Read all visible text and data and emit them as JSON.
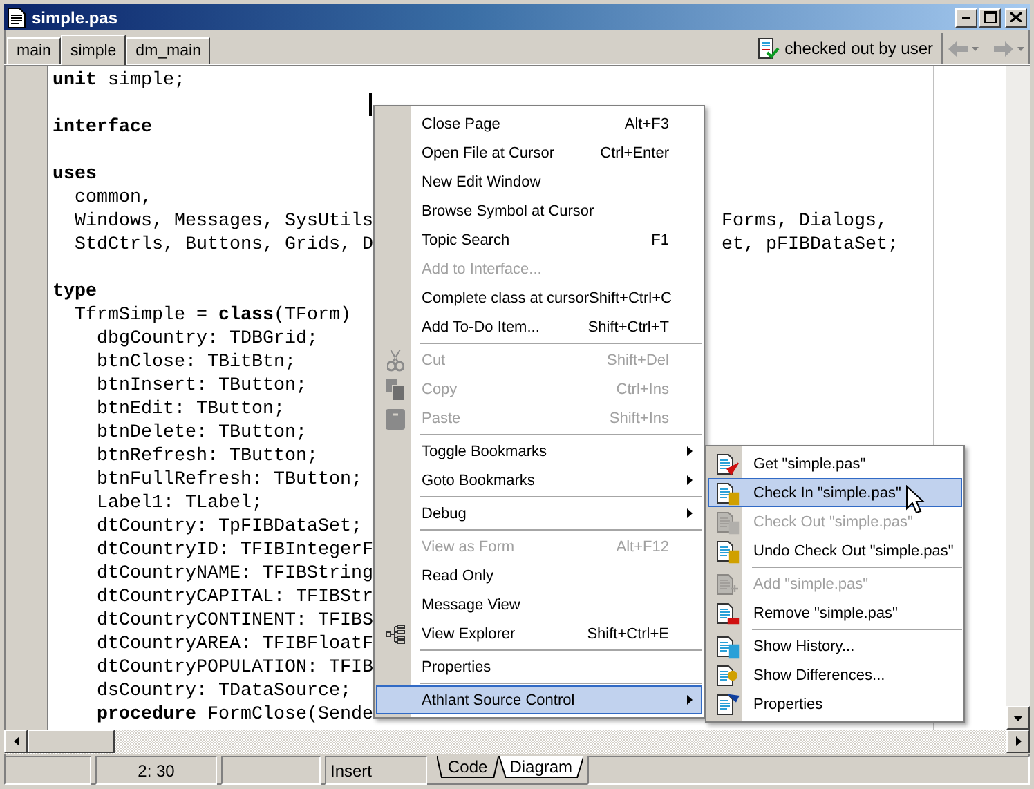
{
  "window": {
    "title": "simple.pas"
  },
  "tabs": [
    {
      "label": "main",
      "selected": false
    },
    {
      "label": "simple",
      "selected": true
    },
    {
      "label": "dm_main",
      "selected": false
    }
  ],
  "source_status": "checked out by user",
  "editor": {
    "lines": [
      {
        "kind": "code",
        "text": "**unit** simple;"
      },
      {
        "kind": "blank"
      },
      {
        "kind": "code",
        "text": "interface",
        "bold": true
      },
      {
        "kind": "blank"
      },
      {
        "kind": "code",
        "text": "uses",
        "bold": true
      },
      {
        "kind": "code",
        "text": "  common,"
      },
      {
        "kind": "code",
        "text": "  Windows, Messages, SysUtils",
        "tail": "Forms, Dialogs,"
      },
      {
        "kind": "code",
        "text": "  StdCtrls, Buttons, Grids, D",
        "tail": "et, pFIBDataSet;"
      },
      {
        "kind": "blank"
      },
      {
        "kind": "code",
        "text": "type",
        "bold": true
      },
      {
        "kind": "code",
        "text": "  TfrmSimple = **class**(TForm)"
      },
      {
        "kind": "code",
        "text": "    dbgCountry: TDBGrid;"
      },
      {
        "kind": "code",
        "text": "    btnClose: TBitBtn;"
      },
      {
        "kind": "code",
        "text": "    btnInsert: TButton;"
      },
      {
        "kind": "code",
        "text": "    btnEdit: TButton;"
      },
      {
        "kind": "code",
        "text": "    btnDelete: TButton;"
      },
      {
        "kind": "code",
        "text": "    btnRefresh: TButton;"
      },
      {
        "kind": "code",
        "text": "    btnFullRefresh: TButton;"
      },
      {
        "kind": "code",
        "text": "    Label1: TLabel;"
      },
      {
        "kind": "code",
        "text": "    dtCountry: TpFIBDataSet;"
      },
      {
        "kind": "code",
        "text": "    dtCountryID: TFIBIntegerF"
      },
      {
        "kind": "code",
        "text": "    dtCountryNAME: TFIBString"
      },
      {
        "kind": "code",
        "text": "    dtCountryCAPITAL: TFIBStr"
      },
      {
        "kind": "code",
        "text": "    dtCountryCONTINENT: TFIBS"
      },
      {
        "kind": "code",
        "text": "    dtCountryAREA: TFIBFloatF"
      },
      {
        "kind": "code",
        "text": "    dtCountryPOPULATION: TFIB"
      },
      {
        "kind": "code",
        "text": "    dsCountry: TDataSource;"
      },
      {
        "kind": "code",
        "text": "    **procedure** FormClose(Sende"
      }
    ]
  },
  "context_menu": {
    "items": [
      {
        "kind": "item",
        "label": "Close Page",
        "shortcut": "Alt+F3",
        "disabled": false,
        "selected": false,
        "submenu": false
      },
      {
        "kind": "item",
        "label": "Open File at Cursor",
        "shortcut": "Ctrl+Enter",
        "disabled": false,
        "selected": false,
        "submenu": false
      },
      {
        "kind": "item",
        "label": "New Edit Window",
        "disabled": false,
        "selected": false,
        "submenu": false
      },
      {
        "kind": "item",
        "label": "Browse Symbol at Cursor",
        "disabled": false,
        "selected": false,
        "submenu": false
      },
      {
        "kind": "item",
        "label": "Topic Search",
        "shortcut": "F1",
        "disabled": false,
        "selected": false,
        "submenu": false
      },
      {
        "kind": "item",
        "label": "Add to Interface...",
        "disabled": true,
        "selected": false,
        "submenu": false
      },
      {
        "kind": "item",
        "label": "Complete class at cursor",
        "shortcut": "Shift+Ctrl+C",
        "disabled": false,
        "selected": false,
        "submenu": false
      },
      {
        "kind": "item",
        "label": "Add To-Do Item...",
        "shortcut": "Shift+Ctrl+T",
        "disabled": false,
        "selected": false,
        "submenu": false
      },
      {
        "kind": "separator"
      },
      {
        "kind": "item",
        "label": "Cut",
        "shortcut": "Shift+Del",
        "disabled": true,
        "selected": false,
        "submenu": false
      },
      {
        "kind": "item",
        "label": "Copy",
        "shortcut": "Ctrl+Ins",
        "disabled": true,
        "selected": false,
        "submenu": false
      },
      {
        "kind": "item",
        "label": "Paste",
        "shortcut": "Shift+Ins",
        "disabled": true,
        "selected": false,
        "submenu": false
      },
      {
        "kind": "separator"
      },
      {
        "kind": "item",
        "label": "Toggle Bookmarks",
        "disabled": false,
        "selected": false,
        "submenu": true
      },
      {
        "kind": "item",
        "label": "Goto Bookmarks",
        "disabled": false,
        "selected": false,
        "submenu": true
      },
      {
        "kind": "separator"
      },
      {
        "kind": "item",
        "label": "Debug",
        "disabled": false,
        "selected": false,
        "submenu": true
      },
      {
        "kind": "separator"
      },
      {
        "kind": "item",
        "label": "View as Form",
        "shortcut": "Alt+F12",
        "disabled": true,
        "selected": false,
        "submenu": false
      },
      {
        "kind": "item",
        "label": "Read Only",
        "disabled": false,
        "selected": false,
        "submenu": false
      },
      {
        "kind": "item",
        "label": "Message View",
        "disabled": false,
        "selected": false,
        "submenu": false
      },
      {
        "kind": "item",
        "label": "View Explorer",
        "shortcut": "Shift+Ctrl+E",
        "disabled": false,
        "selected": false,
        "submenu": false
      },
      {
        "kind": "separator"
      },
      {
        "kind": "item",
        "label": "Properties",
        "disabled": false,
        "selected": false,
        "submenu": false
      },
      {
        "kind": "separator"
      },
      {
        "kind": "item",
        "label": "Athlant Source Control",
        "disabled": false,
        "selected": true,
        "submenu": true
      }
    ]
  },
  "submenu": {
    "items": [
      {
        "kind": "item",
        "label": "Get \"simple.pas\"",
        "disabled": false,
        "selected": false
      },
      {
        "kind": "item",
        "label": "Check In \"simple.pas\"",
        "disabled": false,
        "selected": true
      },
      {
        "kind": "item",
        "label": "Check Out \"simple.pas\"",
        "disabled": true,
        "selected": false
      },
      {
        "kind": "item",
        "label": "Undo Check Out \"simple.pas\"",
        "disabled": false,
        "selected": false
      },
      {
        "kind": "separator"
      },
      {
        "kind": "item",
        "label": "Add \"simple.pas\"",
        "disabled": true,
        "selected": false
      },
      {
        "kind": "item",
        "label": "Remove \"simple.pas\"",
        "disabled": false,
        "selected": false
      },
      {
        "kind": "separator"
      },
      {
        "kind": "item",
        "label": "Show History...",
        "disabled": false,
        "selected": false
      },
      {
        "kind": "item",
        "label": "Show Differences...",
        "disabled": false,
        "selected": false
      },
      {
        "kind": "item",
        "label": "Properties",
        "disabled": false,
        "selected": false
      }
    ]
  },
  "status_bar": {
    "position": "2:  30",
    "mode": "Insert"
  },
  "view_tabs": [
    {
      "label": "Code",
      "selected": true
    },
    {
      "label": "Diagram",
      "selected": false
    }
  ]
}
